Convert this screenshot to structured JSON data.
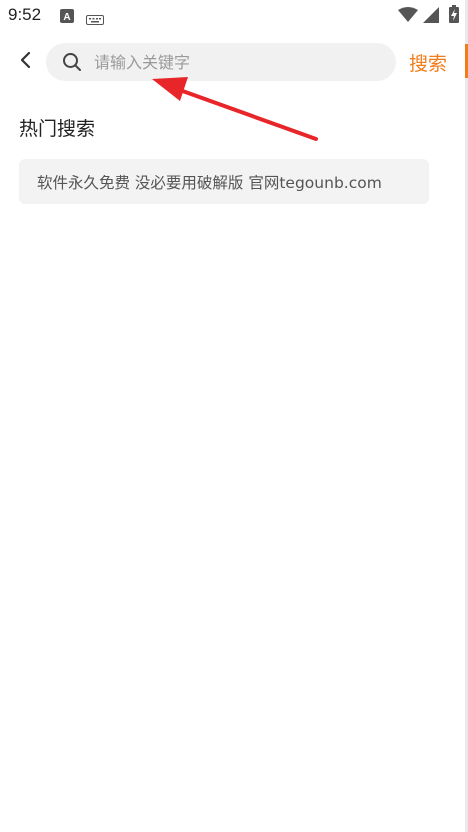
{
  "status_bar": {
    "time": "9:52",
    "icons": [
      "a-notification-icon",
      "keyboard-icon",
      "wifi-icon",
      "signal-icon",
      "battery-charging-icon"
    ]
  },
  "search": {
    "placeholder": "请输入关键字",
    "submit_label": "搜索"
  },
  "hot_search": {
    "title": "热门搜索",
    "tags": [
      "软件永久免费 没必要用破解版 官网tegounb.com"
    ]
  },
  "colors": {
    "accent": "#f07c1a",
    "annotation_arrow": "#e8262a",
    "search_box_bg": "#f1f1f1",
    "tag_bg": "#f3f3f3"
  }
}
